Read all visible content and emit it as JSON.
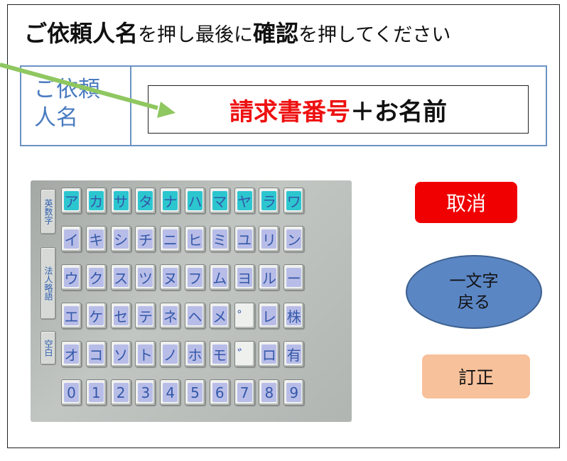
{
  "instruction": {
    "part1": "ご依頼人名",
    "part2": "を押し最後に",
    "part3": "確認",
    "part4": "を押してください"
  },
  "field": {
    "label_line1": "ご依頼",
    "label_line2": "人名",
    "value_red": "請求書番号",
    "value_rest": "＋お名前"
  },
  "keyboard": {
    "side_keys": [
      "英数字",
      "法人略語",
      "空白"
    ],
    "rows": [
      [
        "ア",
        "カ",
        "サ",
        "タ",
        "ナ",
        "ハ",
        "マ",
        "ヤ",
        "ラ",
        "ワ"
      ],
      [
        "イ",
        "キ",
        "シ",
        "チ",
        "ニ",
        "ヒ",
        "ミ",
        "ユ",
        "リ",
        "ン"
      ],
      [
        "ウ",
        "ク",
        "ス",
        "ツ",
        "ヌ",
        "フ",
        "ム",
        "ヨ",
        "ル",
        "ー"
      ],
      [
        "エ",
        "ケ",
        "セ",
        "テ",
        "ネ",
        "ヘ",
        "メ",
        "゜",
        "レ",
        "株"
      ],
      [
        "オ",
        "コ",
        "ソ",
        "ト",
        "ノ",
        "ホ",
        "モ",
        "゛",
        "ロ",
        "有"
      ],
      [
        "0",
        "1",
        "2",
        "3",
        "4",
        "5",
        "6",
        "7",
        "8",
        "9"
      ]
    ]
  },
  "buttons": {
    "cancel": "取消",
    "back_line1": "一文字",
    "back_line2": "戻る",
    "correct": "訂正"
  },
  "colors": {
    "field_border": "#6b93c4",
    "label_text": "#4a7cc0",
    "highlight_red": "#ee1111",
    "arrow_green": "#8fc760",
    "cancel_bg": "#f00000",
    "back_bg": "#5b86c4",
    "correct_bg": "#f7c19b",
    "key_teal": "#2cc6cf",
    "key_lavender": "#b8bde8"
  }
}
